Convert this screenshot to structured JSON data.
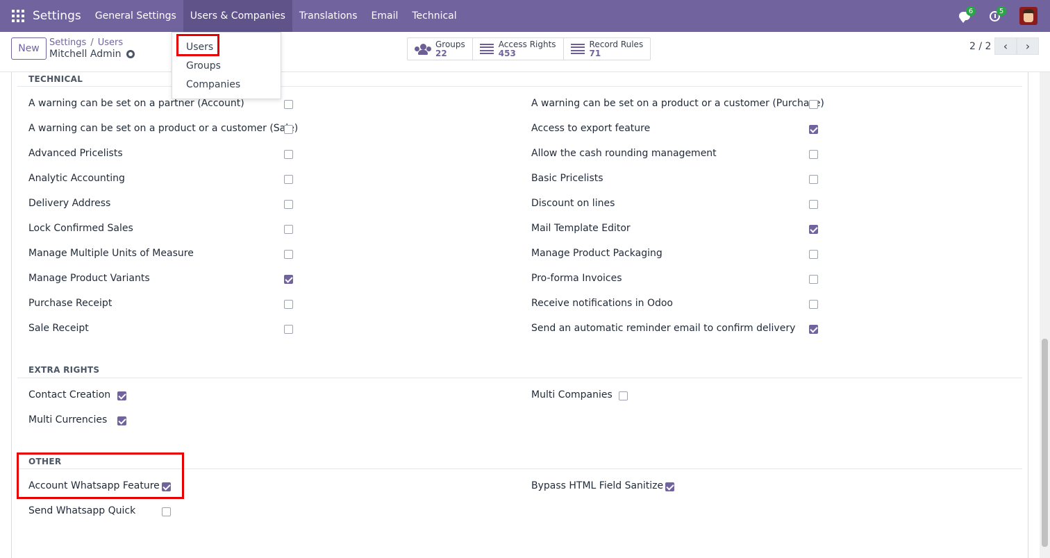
{
  "navbar": {
    "brand": "Settings",
    "menu": [
      "General Settings",
      "Users & Companies",
      "Translations",
      "Email",
      "Technical"
    ],
    "chat_count": "6",
    "activity_count": "5"
  },
  "dropdown": {
    "items": [
      "Users",
      "Groups",
      "Companies"
    ]
  },
  "control_panel": {
    "new_label": "New",
    "breadcrumb": [
      "Settings",
      "Users"
    ],
    "breadcrumb_sep": "/",
    "record_title": "Mitchell Admin",
    "smart_buttons": [
      {
        "label": "Groups",
        "value": "22",
        "icon": "users-icon"
      },
      {
        "label": "Access Rights",
        "value": "453",
        "icon": "list-icon"
      },
      {
        "label": "Record Rules",
        "value": "71",
        "icon": "list-icon"
      }
    ],
    "pager": "2 / 2",
    "prev": "‹",
    "next": "›"
  },
  "sections": {
    "technical": {
      "title": "TECHNICAL",
      "left": [
        {
          "label": "A warning can be set on a partner (Account)",
          "checked": false
        },
        {
          "label": "A warning can be set on a product or a customer (Sale)",
          "checked": false
        },
        {
          "label": "Advanced Pricelists",
          "checked": false
        },
        {
          "label": "Analytic Accounting",
          "checked": false
        },
        {
          "label": "Delivery Address",
          "checked": false
        },
        {
          "label": "Lock Confirmed Sales",
          "checked": false
        },
        {
          "label": "Manage Multiple Units of Measure",
          "checked": false
        },
        {
          "label": "Manage Product Variants",
          "checked": true
        },
        {
          "label": "Purchase Receipt",
          "checked": false
        },
        {
          "label": "Sale Receipt",
          "checked": false
        }
      ],
      "right": [
        {
          "label": "A warning can be set on a product or a customer (Purchase)",
          "checked": false
        },
        {
          "label": "Access to export feature",
          "checked": true
        },
        {
          "label": "Allow the cash rounding management",
          "checked": false
        },
        {
          "label": "Basic Pricelists",
          "checked": false
        },
        {
          "label": "Discount on lines",
          "checked": false
        },
        {
          "label": "Mail Template Editor",
          "checked": true
        },
        {
          "label": "Manage Product Packaging",
          "checked": false
        },
        {
          "label": "Pro-forma Invoices",
          "checked": false
        },
        {
          "label": "Receive notifications in Odoo",
          "checked": false
        },
        {
          "label": "Send an automatic reminder email to confirm delivery",
          "checked": true
        }
      ]
    },
    "extra_rights": {
      "title": "EXTRA RIGHTS",
      "left": [
        {
          "label": "Contact Creation",
          "checked": true
        },
        {
          "label": "Multi Currencies",
          "checked": true
        }
      ],
      "right": [
        {
          "label": "Multi Companies",
          "checked": false
        }
      ]
    },
    "other": {
      "title": "OTHER",
      "left": [
        {
          "label": "Account Whatsapp Feature",
          "checked": true
        },
        {
          "label": "Send Whatsapp Quick",
          "checked": false
        }
      ],
      "right": [
        {
          "label": "Bypass HTML Field Sanitize",
          "checked": true
        }
      ]
    }
  }
}
